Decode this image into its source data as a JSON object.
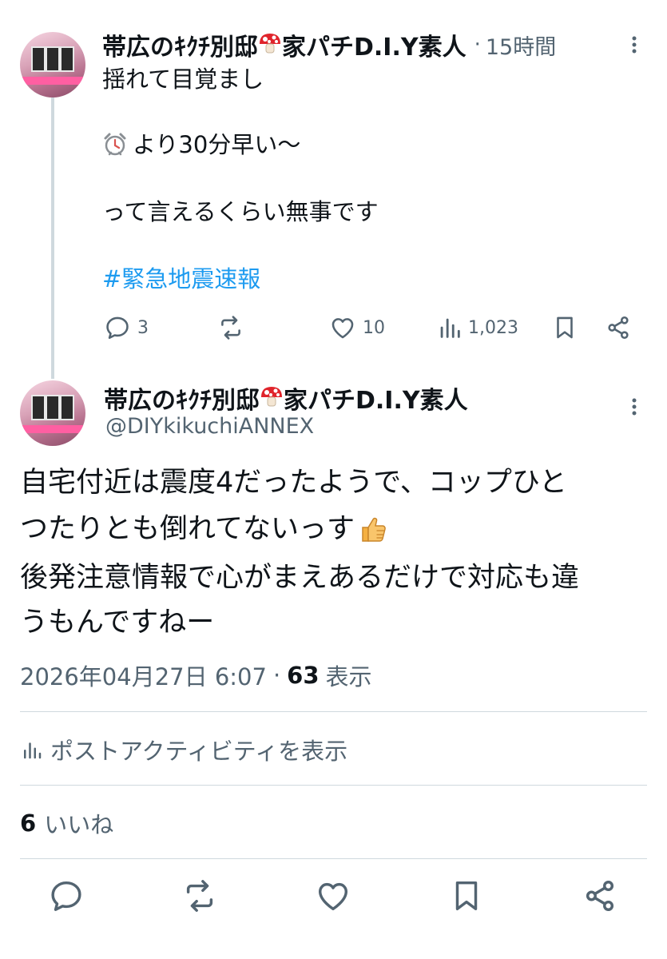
{
  "reply": {
    "author_name": "帯広のｷｸﾁ別邸",
    "author_name_suffix": "家パチD.I.Y素人",
    "mushroom_icon": "mushroom-emoji",
    "time_sep": "·",
    "time_ago": "15時間",
    "text": {
      "line1": "揺れて目覚まし",
      "alarm_icon": "alarm-clock-emoji",
      "line2": "より30分早い〜",
      "line3": "って言えるくらい無事です",
      "hashtag": "#緊急地震速報"
    },
    "actions": {
      "replies": "3",
      "retweets": "",
      "likes": "10",
      "views": "1,023"
    }
  },
  "main": {
    "author_name": "帯広のｷｸﾁ別邸",
    "author_name_suffix": "家パチD.I.Y素人",
    "handle": "@DIYkikuchiANNEX",
    "text": {
      "line1": "自宅付近は震度4だったようで、コップひと",
      "line2": "つたりとも倒れてないっす",
      "thumbs_icon": "thumbs-up-emoji",
      "line3": "後発注意情報で心がまえあるだけで対応も違",
      "line4": "うもんですねー"
    },
    "timestamp": "2026年04月27日 6:07",
    "dot": "·",
    "view_count": "63",
    "view_label": "表示",
    "activity_label": "ポストアクティビティを表示",
    "like_count": "6",
    "like_label": "いいね"
  },
  "colors": {
    "text": "#0f1419",
    "muted": "#536471",
    "link": "#1d9bf0",
    "divider": "#eff3f4"
  }
}
